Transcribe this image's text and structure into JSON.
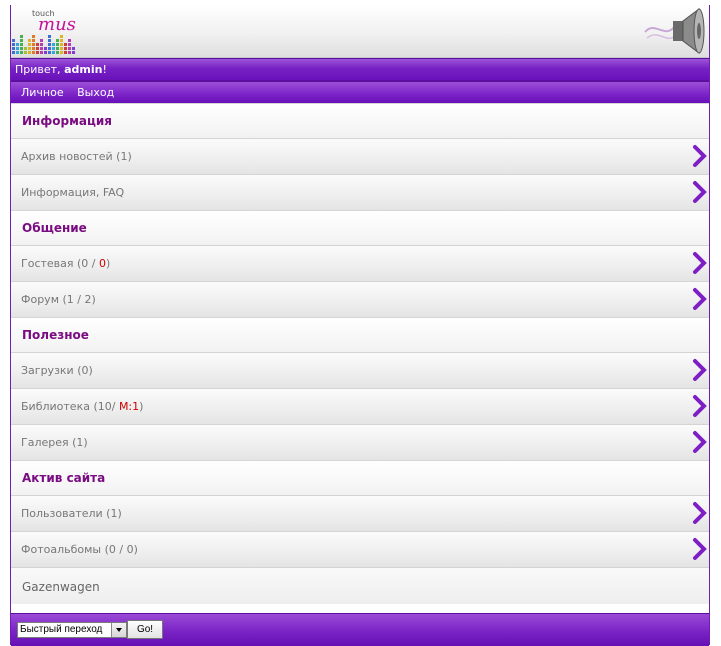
{
  "logo": {
    "small": "touch",
    "main": "mus"
  },
  "greeting": {
    "prefix": "Привет, ",
    "user": "admin",
    "suffix": "!"
  },
  "usernav": [
    "Личное",
    "Выход"
  ],
  "sections": [
    {
      "title": "Информация",
      "items": [
        {
          "label": "Архив новостей (1)"
        },
        {
          "label": "Информация, FAQ"
        }
      ]
    },
    {
      "title": "Общение",
      "items": [
        {
          "label": "Гостевая (0 / ",
          "red": "0",
          "tail": ")"
        },
        {
          "label": "Форум (1 / 2)"
        }
      ]
    },
    {
      "title": "Полезное",
      "items": [
        {
          "label": "Загрузки (0)"
        },
        {
          "label": "Библиотека (10/ ",
          "red": "М:1",
          "tail": ")"
        },
        {
          "label": "Галерея (1)"
        }
      ]
    },
    {
      "title": "Актив сайта",
      "items": [
        {
          "label": "Пользователи (1)"
        },
        {
          "label": "Фотоальбомы (0 / 0)"
        }
      ]
    }
  ],
  "online": "Gazenwagen",
  "footer": {
    "select_value": "Быстрый переход",
    "go_label": "Go!"
  },
  "colors": {
    "accent": "#7621c4",
    "section_title": "#7a0c82",
    "counter_red": "#d00000"
  }
}
